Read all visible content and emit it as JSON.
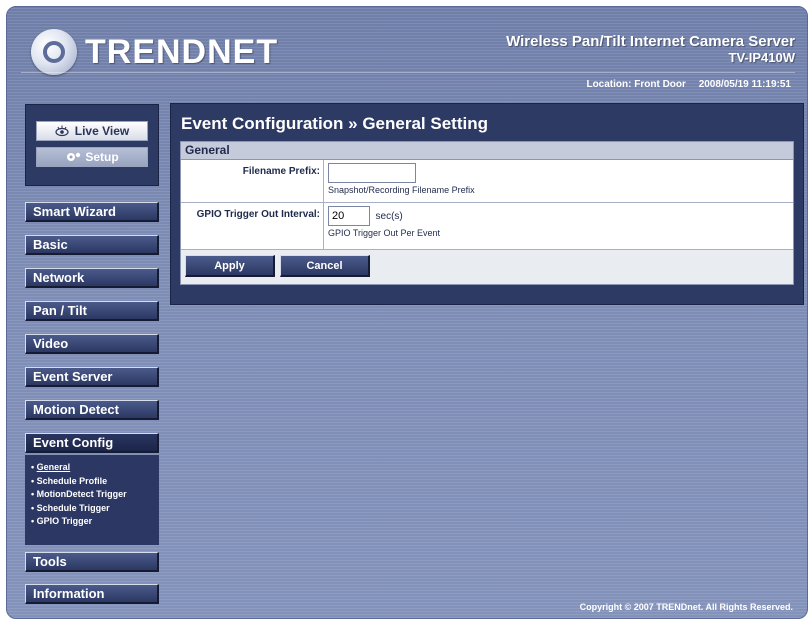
{
  "header": {
    "logo_text": "TRENDNET",
    "product_name": "Wireless Pan/Tilt Internet Camera Server",
    "product_model": "TV-IP410W",
    "location": "Location: Front Door",
    "datetime": "2008/05/19 11:19:51"
  },
  "sidebar": {
    "live_view": "Live View",
    "setup": "Setup",
    "menu": [
      "Smart Wizard",
      "Basic",
      "Network",
      "Pan / Tilt",
      "Video",
      "Event Server",
      "Motion Detect",
      "Event Config",
      "Tools",
      "Information"
    ],
    "event_config_submenu": [
      "General",
      "Schedule Profile",
      "MotionDetect Trigger",
      "Schedule Trigger",
      "GPIO Trigger"
    ]
  },
  "main": {
    "title": "Event Configuration » General Setting",
    "section": "General",
    "filename_prefix": {
      "label": "Filename Prefix:",
      "value": "",
      "hint": "Snapshot/Recording Filename Prefix"
    },
    "gpio_interval": {
      "label": "GPIO Trigger Out Interval:",
      "value": "20",
      "unit": "sec(s)",
      "hint": "GPIO Trigger Out Per Event"
    },
    "apply_label": "Apply",
    "cancel_label": "Cancel"
  },
  "footer": {
    "copyright": "Copyright © 2007 TRENDnet. All Rights Reserved."
  }
}
